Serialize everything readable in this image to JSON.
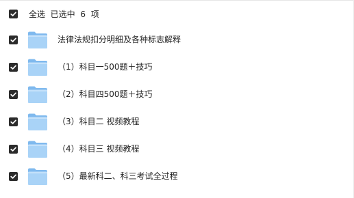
{
  "header": {
    "select_all_label": "全选",
    "selected_prefix": "已选中",
    "selected_count": "6",
    "selected_unit": "项"
  },
  "files": [
    {
      "name": "法律法规扣分明细及各种标志解释"
    },
    {
      "name": "（1）科目一500题＋技巧"
    },
    {
      "name": "（2）科目四500题＋技巧"
    },
    {
      "name": "（3）科目二 视频教程"
    },
    {
      "name": "（4）科目三 视频教程"
    },
    {
      "name": "（5）最新科二、科三考试全过程"
    }
  ],
  "colors": {
    "checkbox_fill": "#2b2b2b",
    "folder_back": "#7fb9ee",
    "folder_front": "#a9d3f7"
  },
  "icons": {
    "checkbox": "checkmark-icon",
    "folder": "folder-icon"
  }
}
